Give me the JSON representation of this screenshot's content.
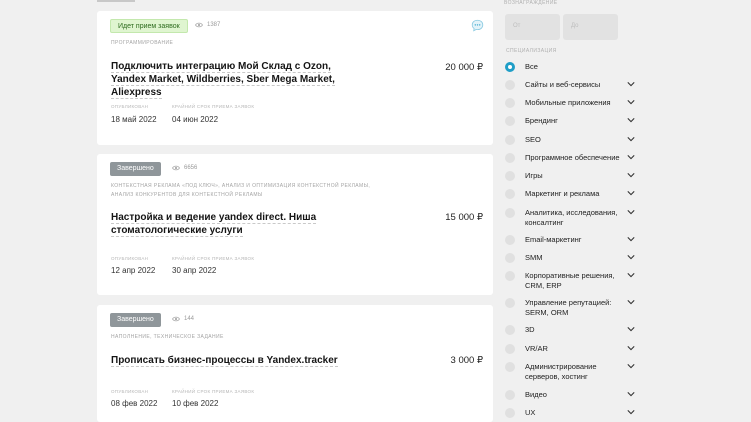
{
  "orders": [
    {
      "status": "Идет прием заявок",
      "status_kind": "open",
      "views": "1387",
      "category": "Программирование",
      "title": "Подключить интеграцию Мой Склад с Ozon, Yandex Market, Wildberries, Sber Mega Market, Aliexpress",
      "price": "20 000 ₽",
      "published_label": "Опубликован",
      "published": "18 май 2022",
      "deadline_label": "Крайний срок приема заявок",
      "deadline": "04 июн 2022"
    },
    {
      "status": "Завершено",
      "status_kind": "done",
      "views": "6656",
      "category": "Контекстная реклама «под ключ», Анализ и оптимизация контекстной рекламы, Анализ конкурентов для контекстной рекламы",
      "title": "Настройка и ведение yandex direct. Ниша стоматологические услуги",
      "price": "15 000 ₽",
      "published_label": "Опубликован",
      "published": "12 апр 2022",
      "deadline_label": "Крайний срок приема заявок",
      "deadline": "30 апр 2022"
    },
    {
      "status": "Завершено",
      "status_kind": "done",
      "views": "144",
      "category": "Наполнение, Техническое задание",
      "title": "Прописать бизнес-процессы в Yandex.tracker",
      "price": "3 000 ₽",
      "published_label": "Опубликован",
      "published": "08 фев 2022",
      "deadline_label": "Крайний срок приема заявок",
      "deadline": "10 фев 2022"
    }
  ],
  "sidebar": {
    "budget_heading": "Вознаграждение",
    "budget_from": "От",
    "budget_to": "До",
    "spec_heading": "Специализация",
    "items": [
      "Все",
      "Сайты и веб-сервисы",
      "Мобильные приложения",
      "Брендинг",
      "SEO",
      "Программное обеспечение",
      "Игры",
      "Маркетинг и реклама",
      "Аналитика, исследования, консалтинг",
      "Email-маркетинг",
      "SMM",
      "Корпоративные решения, CRM, ERP",
      "Управление репутацией: SERM, ORM",
      "3D",
      "VR/AR",
      "Администрирование серверов, хостинг",
      "Видео",
      "UX"
    ]
  },
  "colors": {
    "accent": "#1f9ec7",
    "open_badge": "#dff5d0",
    "done_badge": "#8f969a",
    "background": "#f0f0f0"
  }
}
